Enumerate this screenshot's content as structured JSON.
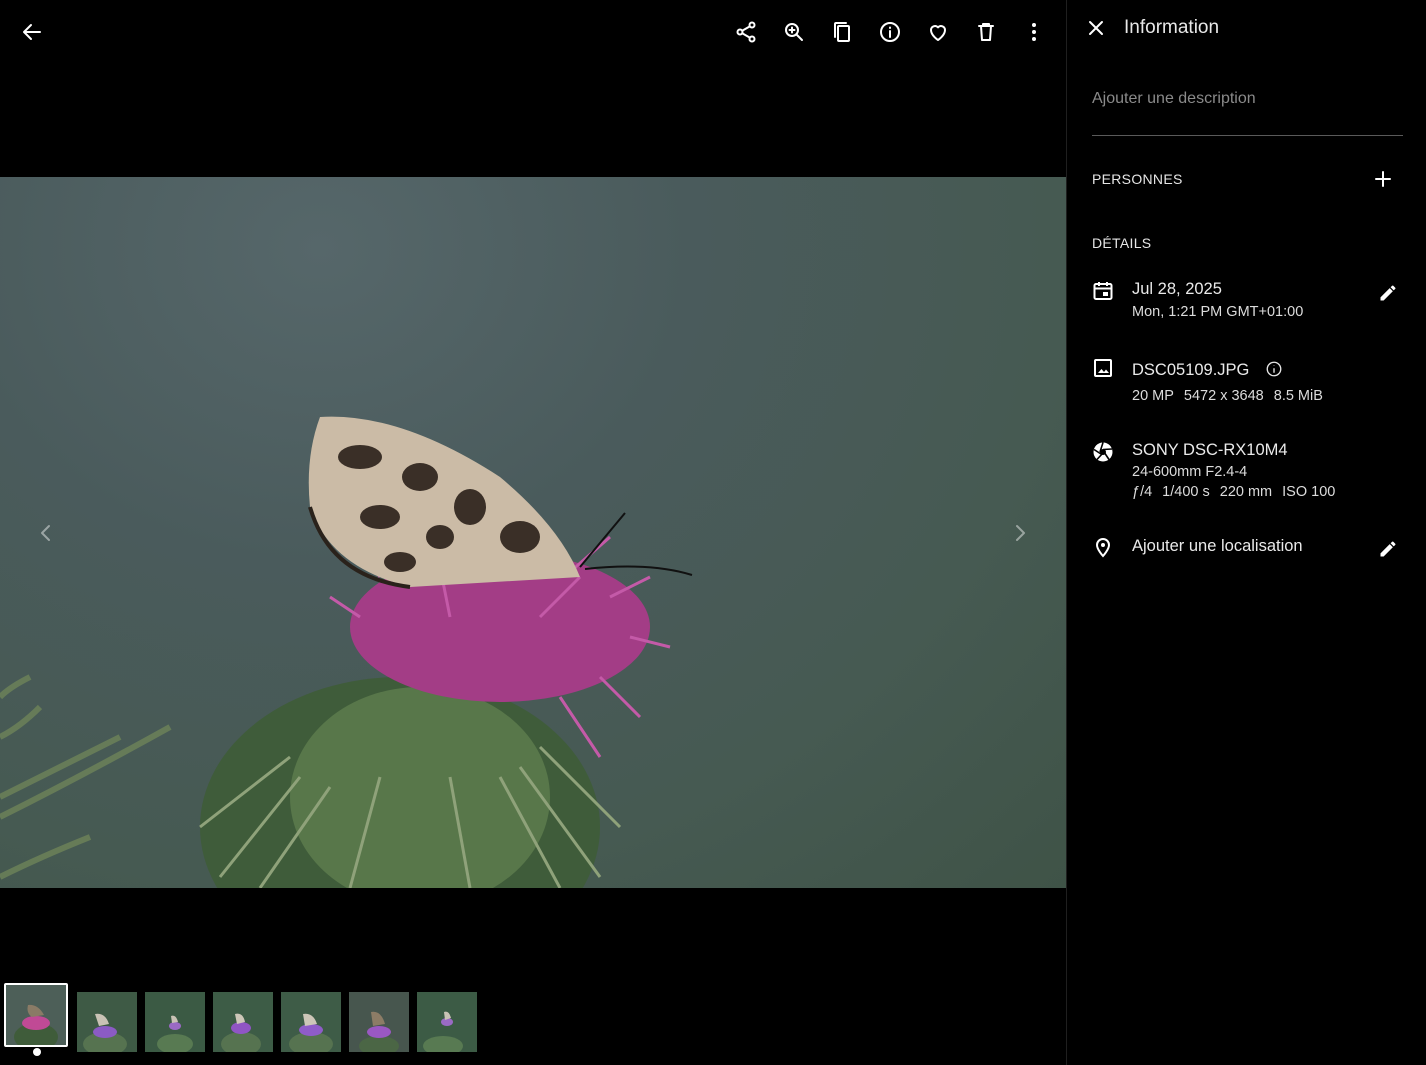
{
  "viewer": {
    "toolbar": {
      "back": "arrow-left-icon",
      "actions": [
        "share-icon",
        "zoom-in-icon",
        "copy-icon",
        "info-icon",
        "favorite-icon",
        "delete-icon",
        "more-vert-icon"
      ]
    },
    "prev": "chevron-left-icon",
    "next": "chevron-right-icon",
    "filmstrip": {
      "count": 7,
      "selected_index": 0
    }
  },
  "info_panel": {
    "title": "Information",
    "description_placeholder": "Ajouter une description",
    "people": {
      "label": "PERSONNES"
    },
    "details": {
      "label": "DÉTAILS",
      "date": {
        "primary": "Jul 28, 2025",
        "secondary": "Mon, 1:21 PM GMT+01:00"
      },
      "file": {
        "name": "DSC05109.JPG",
        "megapixels": "20 MP",
        "resolution": "5472 x 3648",
        "size": "8.5 MiB"
      },
      "camera": {
        "model": "SONY DSC-RX10M4",
        "lens": "24-600mm F2.4-4",
        "aperture": "ƒ/4",
        "shutter": "1/400 s",
        "focal": "220 mm",
        "iso": "ISO 100"
      },
      "location": {
        "label": "Ajouter une localisation"
      }
    }
  },
  "colors": {
    "background": "#000000",
    "thistle": "#b0428f",
    "accent_text": "#eaeaea",
    "muted_text": "#8a8a8a"
  }
}
